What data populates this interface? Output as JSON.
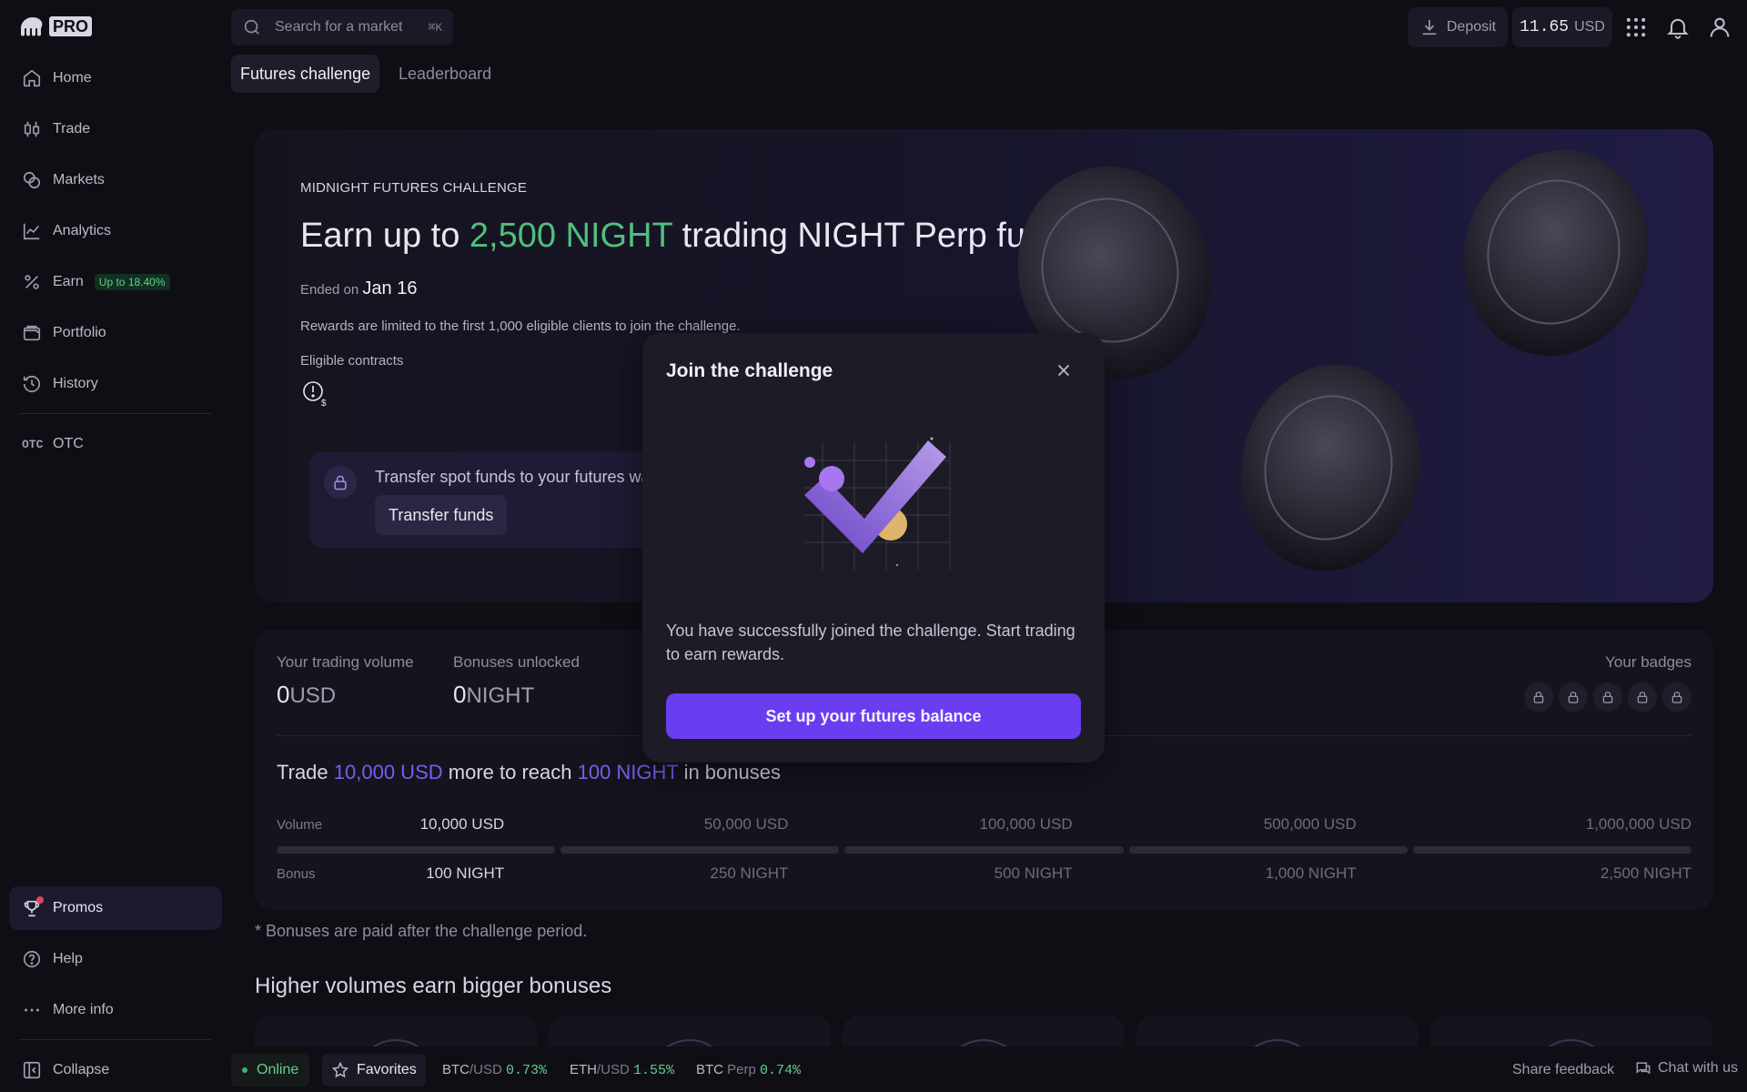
{
  "app": {
    "logo_badge": "PRO"
  },
  "sidebar": {
    "items": [
      {
        "label": "Home",
        "icon": "home-icon"
      },
      {
        "label": "Trade",
        "icon": "candlestick-icon"
      },
      {
        "label": "Markets",
        "icon": "coins-icon"
      },
      {
        "label": "Analytics",
        "icon": "chart-line-icon"
      },
      {
        "label": "Earn",
        "icon": "percent-icon",
        "badge": "Up to 18.40%"
      },
      {
        "label": "Portfolio",
        "icon": "wallet-icon"
      },
      {
        "label": "History",
        "icon": "history-icon"
      },
      {
        "label": "OTC",
        "icon": "otc-icon",
        "icon_text": "OTC"
      }
    ],
    "bottom": [
      {
        "label": "Promos",
        "icon": "trophy-icon"
      },
      {
        "label": "Help",
        "icon": "help-icon"
      },
      {
        "label": "More info",
        "icon": "more-icon"
      },
      {
        "label": "Collapse",
        "icon": "collapse-icon"
      }
    ]
  },
  "topbar": {
    "search_placeholder": "Search for a market",
    "search_shortcut": "⌘K",
    "deposit_label": "Deposit",
    "balance_value": "11.65",
    "balance_currency": "USD"
  },
  "tabs": [
    {
      "label": "Futures challenge",
      "active": true
    },
    {
      "label": "Leaderboard",
      "active": false
    }
  ],
  "hero": {
    "eyebrow": "MIDNIGHT FUTURES CHALLENGE",
    "title_pre": "Earn up to ",
    "title_highlight": "2,500 NIGHT",
    "title_post": " trading NIGHT Perp futures",
    "ended_prefix": "Ended on",
    "ended_date": "Jan 16",
    "rewards_note": "Rewards are limited to the first 1,000 eligible clients to join the challenge.",
    "eligible_label": "Eligible contracts",
    "transfer_text": "Transfer spot funds to your futures wallet",
    "transfer_button": "Transfer funds",
    "accent_color": "#4fbf7d"
  },
  "stats": {
    "volume_label": "Your trading volume",
    "volume_value": "0",
    "volume_unit": "USD",
    "bonus_label": "Bonuses unlocked",
    "bonus_value": "0",
    "bonus_unit": "NIGHT",
    "badges_label": "Your badges",
    "badge_count": 5,
    "trade_pre": "Trade ",
    "trade_amount": "10,000 USD",
    "trade_mid": " more to reach ",
    "trade_bonus": "100 NIGHT",
    "trade_post": " in bonuses",
    "volume_row_label": "Volume",
    "bonus_row_label": "Bonus",
    "tiers": [
      {
        "volume": "10,000 USD",
        "bonus": "100 NIGHT",
        "progress": 0
      },
      {
        "volume": "50,000 USD",
        "bonus": "250 NIGHT",
        "progress": 0
      },
      {
        "volume": "100,000 USD",
        "bonus": "500 NIGHT",
        "progress": 0
      },
      {
        "volume": "500,000 USD",
        "bonus": "1,000 NIGHT",
        "progress": 0
      },
      {
        "volume": "1,000,000 USD",
        "bonus": "2,500 NIGHT",
        "progress": 0
      }
    ]
  },
  "footnote": "* Bonuses are paid after the challenge period.",
  "section_title": "Higher volumes earn bigger bonuses",
  "bottombar": {
    "status": "Online",
    "favorites": "Favorites",
    "tickers": [
      {
        "base": "BTC",
        "quote": "/USD",
        "change": "0.73%"
      },
      {
        "base": "ETH",
        "quote": "/USD",
        "change": "1.55%"
      },
      {
        "base": "BTC",
        "quote": " Perp",
        "change": "0.74%"
      }
    ],
    "feedback": "Share feedback",
    "chat": "Chat with us"
  },
  "modal": {
    "title": "Join the challenge",
    "message": "You have successfully joined the challenge. Start trading to earn rewards.",
    "button": "Set up your futures balance",
    "button_color": "#6a3df0"
  }
}
